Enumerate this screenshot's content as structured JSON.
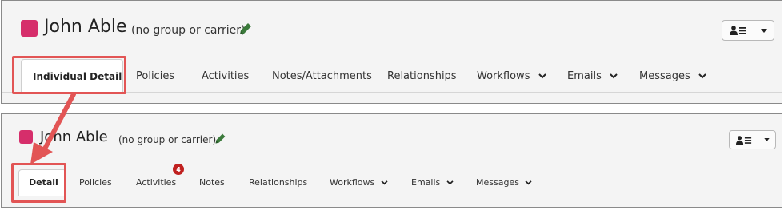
{
  "top": {
    "name": "John Able",
    "subtitle": "(no group or carrier)",
    "tabs": [
      "Individual Detail",
      "Policies",
      "Activities",
      "Notes/Attachments",
      "Relationships",
      "Workflows",
      "Emails",
      "Messages"
    ]
  },
  "bottom": {
    "name": "John Able",
    "subtitle": "(no group or carrier)",
    "tabs": [
      "Detail",
      "Policies",
      "Activities",
      "Notes",
      "Relationships",
      "Workflows",
      "Emails",
      "Messages"
    ],
    "activities_badge": "4"
  },
  "colors": {
    "contact_square": "#d62e6b",
    "highlight": "#e25555",
    "badge": "#c0201f",
    "pencil": "#3b7a3b"
  },
  "icons": {
    "edit": "pencil-icon",
    "contact_menu": "contact-list-icon",
    "dropdown": "caret-down-icon",
    "tab_dropdown": "chevron-down-icon",
    "annotation": "arrow-annotation"
  }
}
